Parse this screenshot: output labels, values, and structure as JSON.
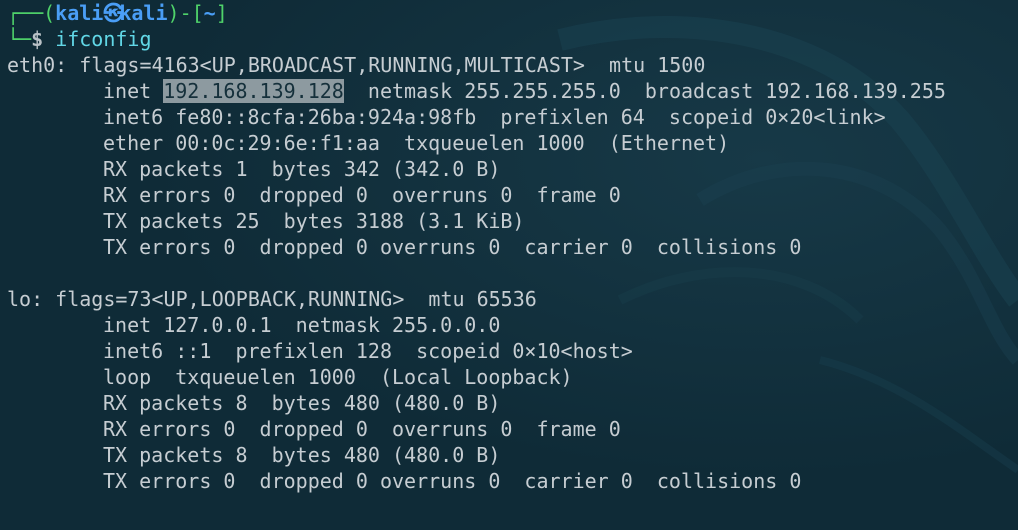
{
  "prompt": {
    "corner_top": "┌──",
    "open_paren": "(",
    "user": "kali",
    "at_symbol": "㉿",
    "host": "kali",
    "close_paren": ")",
    "dash": "-",
    "dir_open": "[",
    "dir": "~",
    "dir_close": "]",
    "corner_bottom": "└─",
    "dollar": "$",
    "command": "ifconfig"
  },
  "interfaces": [
    {
      "header": "eth0: flags=4163<UP,BROADCAST,RUNNING,MULTICAST>  mtu 1500",
      "inet_label": "inet ",
      "inet_addr": "192.168.139.128",
      "inet_rest": "  netmask 255.255.255.0  broadcast 192.168.139.255",
      "lines": [
        "inet6 fe80::8cfa:26ba:924a:98fb  prefixlen 64  scopeid 0×20<link>",
        "ether 00:0c:29:6e:f1:aa  txqueuelen 1000  (Ethernet)",
        "RX packets 1  bytes 342 (342.0 B)",
        "RX errors 0  dropped 0  overruns 0  frame 0",
        "TX packets 25  bytes 3188 (3.1 KiB)",
        "TX errors 0  dropped 0 overruns 0  carrier 0  collisions 0"
      ]
    },
    {
      "header": "lo: flags=73<UP,LOOPBACK,RUNNING>  mtu 65536",
      "inet_label": "inet ",
      "inet_addr": "127.0.0.1",
      "inet_rest": "  netmask 255.0.0.0",
      "lines": [
        "inet6 ::1  prefixlen 128  scopeid 0×10<host>",
        "loop  txqueuelen 1000  (Local Loopback)",
        "RX packets 8  bytes 480 (480.0 B)",
        "RX errors 0  dropped 0  overruns 0  frame 0",
        "TX packets 8  bytes 480 (480.0 B)",
        "TX errors 0  dropped 0 overruns 0  carrier 0  collisions 0"
      ]
    }
  ],
  "colors": {
    "background": "#0f2b37",
    "text": "#c6cdd2",
    "prompt_frame": "#4fd36a",
    "prompt_user": "#4a9ef6",
    "command": "#61d7e6",
    "selection": "#8d9aa0"
  }
}
